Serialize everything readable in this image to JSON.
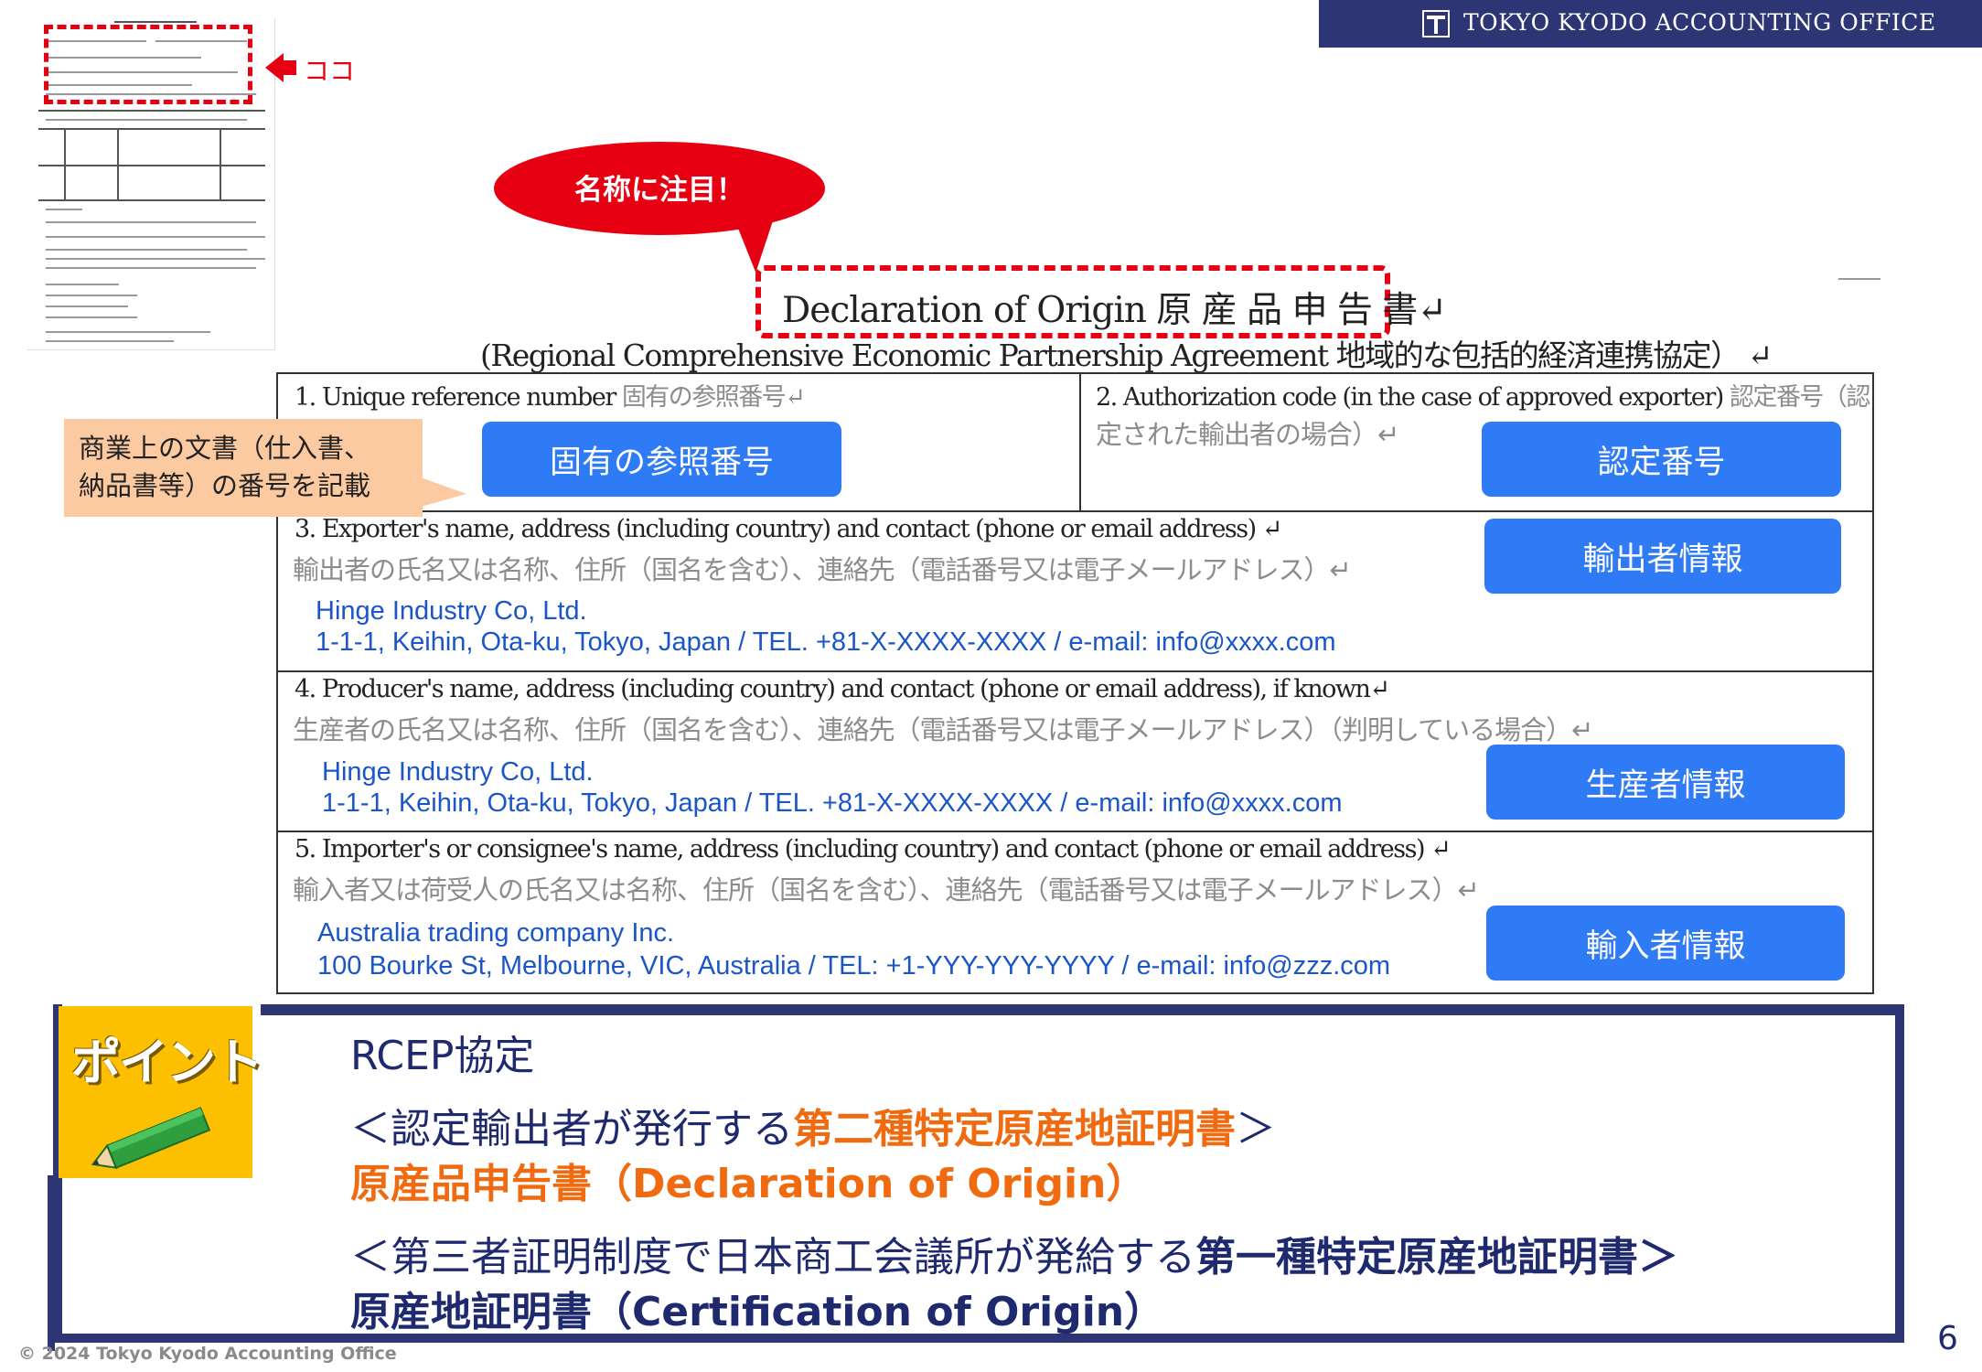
{
  "header": {
    "office_name": "TOKYO KYODO ACCOUNTING OFFICE"
  },
  "thumbnail": {
    "pointer_label": "ココ"
  },
  "bubble": {
    "text": "名称に注目！"
  },
  "title": {
    "main": "Declaration of Origin 原 産 品 申 告 書↵",
    "sub": "(Regional Comprehensive Economic Partnership Agreement 地域的な包括的経済連携協定） ↵"
  },
  "form": {
    "field1": {
      "label_en": "1. Unique reference number ",
      "label_jp": "固有の参照番号↵",
      "button": "固有の参照番号"
    },
    "field2": {
      "label_en": "2. Authorization code (in the case of approved exporter) ",
      "label_jp": "認定番号（認",
      "label_jp2": "定された輸出者の場合）↵",
      "button": "認定番号"
    },
    "field3": {
      "label_en": "3. Exporter's name, address (including country) and contact (phone or email address) ↵",
      "label_jp": "輸出者の氏名又は名称、住所（国名を含む）、連絡先（電話番号又は電子メールアドレス）↵",
      "name": "Hinge Industry Co, Ltd.",
      "address": "1-1-1, Keihin, Ota-ku, Tokyo, Japan / TEL. +81-X-XXXX-XXXX / e-mail: info@xxxx.com",
      "button": "輸出者情報"
    },
    "field4": {
      "label_en": "4. Producer's name, address (including country) and contact (phone or email address), if known↵",
      "label_jp": "生産者の氏名又は名称、住所（国名を含む）、連絡先（電話番号又は電子メールアドレス）（判明している場合）↵",
      "name": "Hinge Industry Co, Ltd.",
      "address": "1-1-1, Keihin, Ota-ku, Tokyo, Japan / TEL. +81-X-XXXX-XXXX / e-mail: info@xxxx.com",
      "button": "生産者情報"
    },
    "field5": {
      "label_en": "5. Importer's or consignee's name, address (including country) and contact (phone or email address) ↵",
      "label_jp": "輸入者又は荷受人の氏名又は名称、住所（国名を含む）、連絡先（電話番号又は電子メールアドレス）↵",
      "name": "Australia trading company Inc.",
      "address": "100 Bourke St, Melbourne, VIC, Australia / TEL: +1-YYY-YYY-YYYY / e-mail: info@zzz.com",
      "button": "輸入者情報"
    }
  },
  "callout": {
    "line1": "商業上の文書（仕入書、",
    "line2": "納品書等）の番号を記載"
  },
  "point": {
    "badge": "ポイント",
    "heading": "RCEP協定",
    "line1_pre": "＜認定輸出者が発行する",
    "line1_em": "第二種特定原産地証明書",
    "line1_post": "＞",
    "line2": "原産品申告書（Declaration of Origin）",
    "line3_pre": "＜第三者証明制度で日本商工会議所が発給する",
    "line3_em": "第一種特定原産地証明書＞",
    "line4": "原産地証明書（Certification of Origin）"
  },
  "footer": {
    "copyright": "© 2024 Tokyo Kyodo Accounting Office",
    "page": "6"
  },
  "colors": {
    "navy": "#2e3574",
    "red": "#e60012",
    "button_blue": "#2f7bf5",
    "orange": "#f06a10",
    "text_blue": "#1a56c8",
    "badge_yellow": "#fdc000"
  }
}
